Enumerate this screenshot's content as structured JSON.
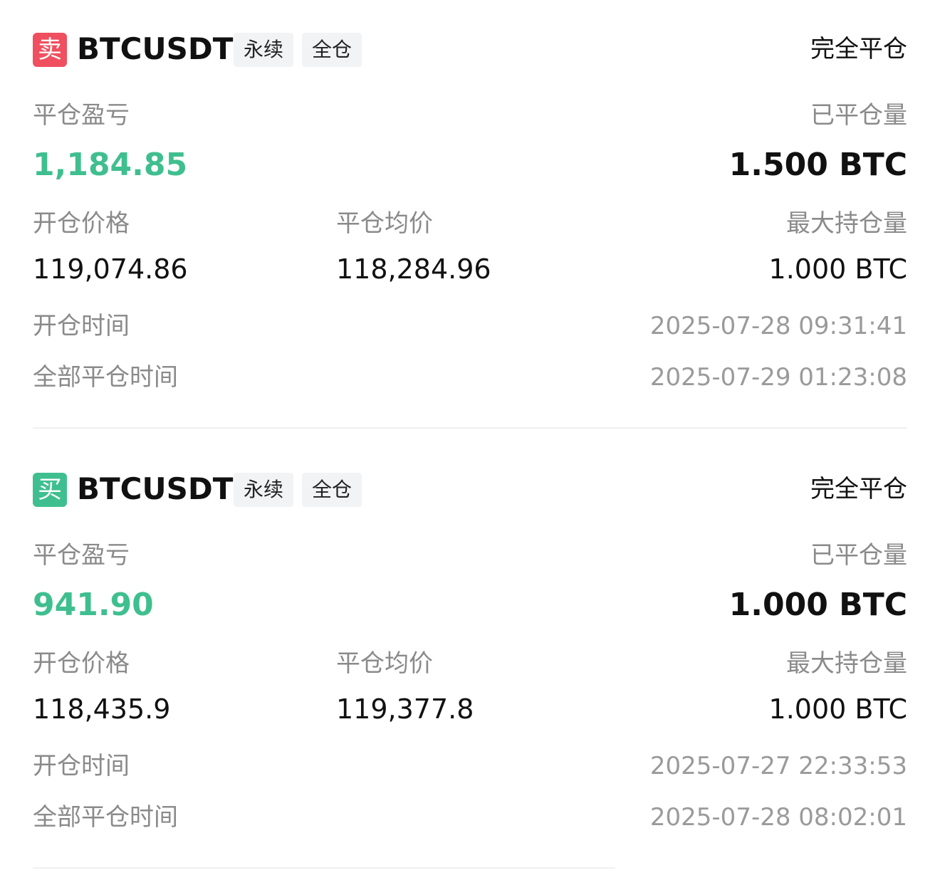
{
  "colors": {
    "sell_badge": "#ef4f5f",
    "buy_badge": "#3fbf8f",
    "profit_text": "#3fbf8f",
    "label_text": "#8a8a8a",
    "tag_bg": "#f2f3f5"
  },
  "labels": {
    "pnl": "平仓盈亏",
    "closed_qty": "已平仓量",
    "open_price": "开仓价格",
    "avg_close_price": "平仓均价",
    "max_position": "最大持仓量",
    "open_time": "开仓时间",
    "full_close_time": "全部平仓时间"
  },
  "records": [
    {
      "side_label": "卖",
      "side": "sell",
      "symbol": "BTCUSDT",
      "tags": [
        "永续",
        "全仓"
      ],
      "status": "完全平仓",
      "pnl": "1,184.85",
      "closed_qty": "1.500 BTC",
      "open_price": "119,074.86",
      "avg_close_price": "118,284.96",
      "max_position": "1.000 BTC",
      "open_time": "2025-07-28 09:31:41",
      "full_close_time": "2025-07-29 01:23:08"
    },
    {
      "side_label": "买",
      "side": "buy",
      "symbol": "BTCUSDT",
      "tags": [
        "永续",
        "全仓"
      ],
      "status": "完全平仓",
      "pnl": "941.90",
      "closed_qty": "1.000 BTC",
      "open_price": "118,435.9",
      "avg_close_price": "119,377.8",
      "max_position": "1.000 BTC",
      "open_time": "2025-07-27 22:33:53",
      "full_close_time": "2025-07-28 08:02:01"
    }
  ]
}
